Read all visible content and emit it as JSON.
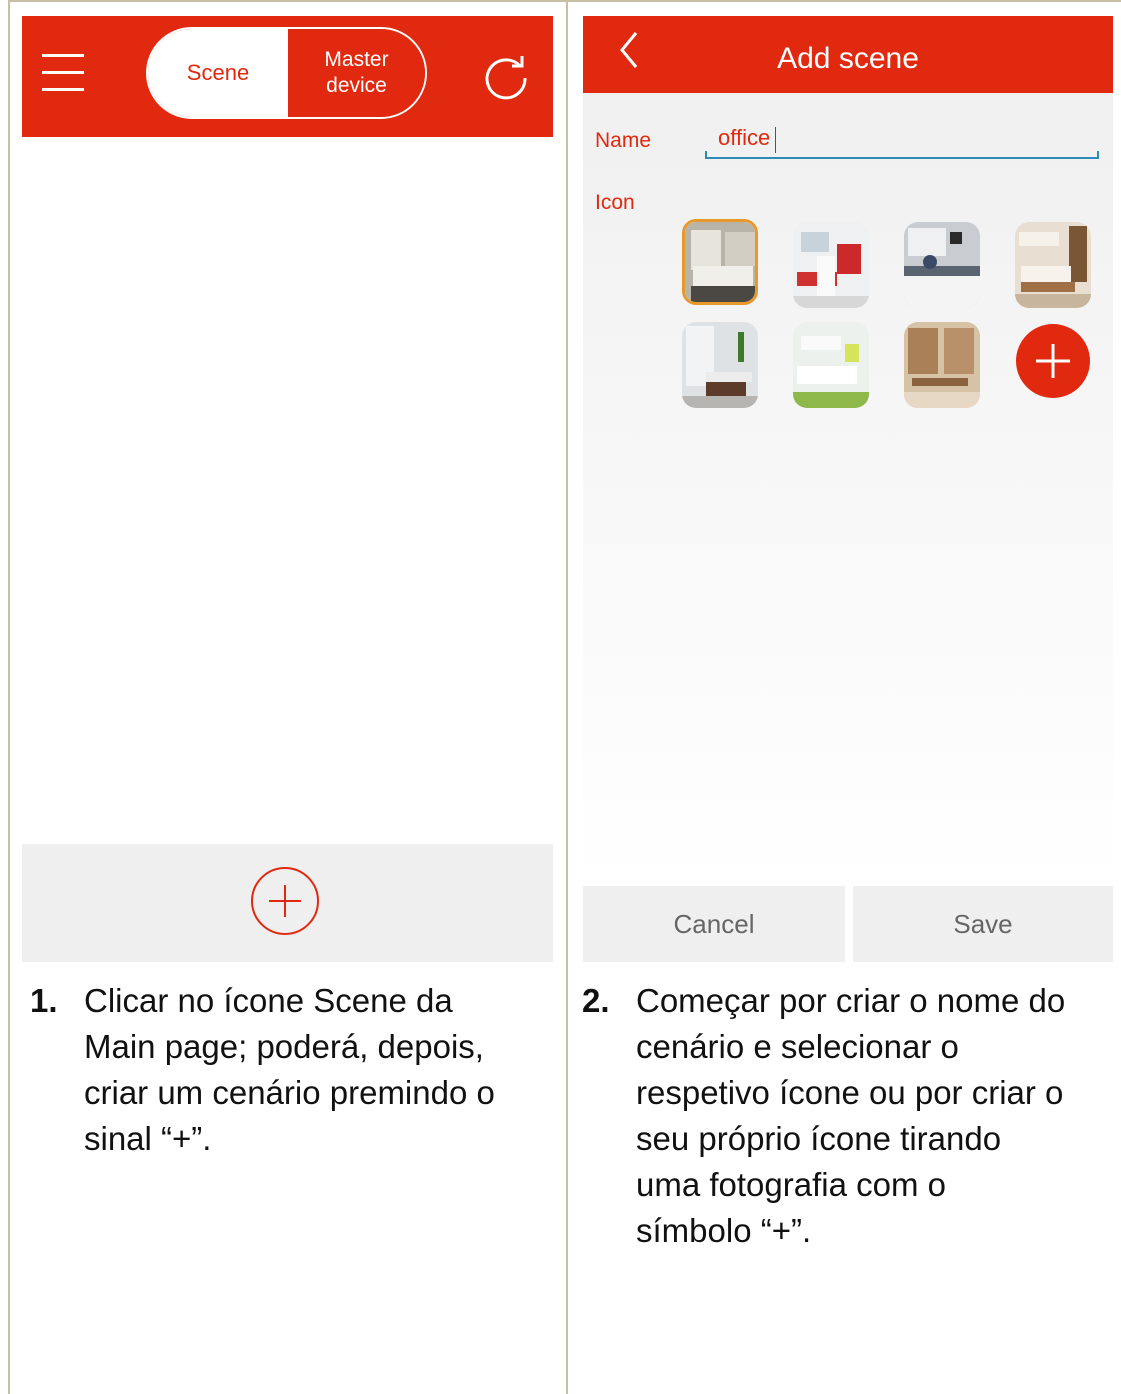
{
  "left_screen": {
    "toggle": {
      "scene_label": "Scene",
      "master_label": "Master\ndevice"
    }
  },
  "right_screen": {
    "title": "Add scene",
    "name_label": "Name",
    "name_value": "office",
    "icon_label": "Icon",
    "cancel_label": "Cancel",
    "save_label": "Save"
  },
  "captions": [
    {
      "num": "1.",
      "lines": [
        "Clicar no ícone Scene da",
        "Main page; poderá, depois,",
        "criar um cenário premindo o",
        "sinal “+”."
      ]
    },
    {
      "num": "2.",
      "lines": [
        "Começar por criar o nome do",
        "cenário e selecionar o",
        "respetivo ícone ou por criar o",
        "seu próprio ícone tirando",
        "uma fotografia com o",
        "símbolo “+”."
      ]
    }
  ],
  "colors": {
    "accent": "#e1290f",
    "selection": "#e8992c",
    "underline": "#2b8bb5"
  }
}
